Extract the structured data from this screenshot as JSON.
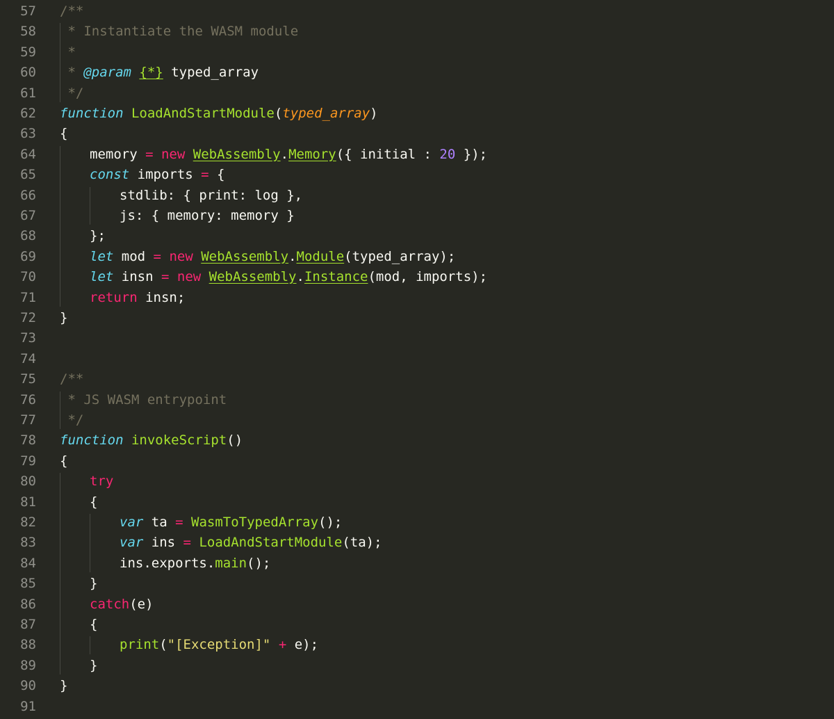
{
  "editor": {
    "background": "#272822",
    "lines": [
      {
        "num": "57",
        "indent": 0,
        "tokens": [
          {
            "t": "/**",
            "c": "c"
          }
        ]
      },
      {
        "num": "58",
        "indent": 0,
        "tokens": [
          {
            "t": " * Instantiate the WASM module",
            "c": "c"
          }
        ]
      },
      {
        "num": "59",
        "indent": 0,
        "tokens": [
          {
            "t": " *",
            "c": "c"
          }
        ]
      },
      {
        "num": "60",
        "indent": 0,
        "tokens": [
          {
            "t": " * ",
            "c": "c"
          },
          {
            "t": "@param",
            "c": "s"
          },
          {
            "t": " ",
            "c": "c"
          },
          {
            "t": "{*}",
            "c": "fu"
          },
          {
            "t": " typed_array",
            "c": "t"
          }
        ]
      },
      {
        "num": "61",
        "indent": 0,
        "tokens": [
          {
            "t": " */",
            "c": "c"
          }
        ]
      },
      {
        "num": "62",
        "indent": 0,
        "tokens": [
          {
            "t": "function",
            "c": "s"
          },
          {
            "t": " ",
            "c": "t"
          },
          {
            "t": "LoadAndStartModule",
            "c": "f"
          },
          {
            "t": "(",
            "c": "t"
          },
          {
            "t": "typed_array",
            "c": "p"
          },
          {
            "t": ")",
            "c": "t"
          }
        ]
      },
      {
        "num": "63",
        "indent": 0,
        "tokens": [
          {
            "t": "{",
            "c": "t"
          }
        ]
      },
      {
        "num": "64",
        "indent": 1,
        "tokens": [
          {
            "t": "memory ",
            "c": "t"
          },
          {
            "t": "=",
            "c": "k"
          },
          {
            "t": " ",
            "c": "t"
          },
          {
            "t": "new",
            "c": "k"
          },
          {
            "t": " ",
            "c": "t"
          },
          {
            "t": "WebAssembly",
            "c": "fu"
          },
          {
            "t": ".",
            "c": "t"
          },
          {
            "t": "Memory",
            "c": "fu"
          },
          {
            "t": "({ initial : ",
            "c": "t"
          },
          {
            "t": "20",
            "c": "n"
          },
          {
            "t": " });",
            "c": "t"
          }
        ]
      },
      {
        "num": "65",
        "indent": 1,
        "tokens": [
          {
            "t": "const",
            "c": "s"
          },
          {
            "t": " imports ",
            "c": "t"
          },
          {
            "t": "=",
            "c": "k"
          },
          {
            "t": " {",
            "c": "t"
          }
        ]
      },
      {
        "num": "66",
        "indent": 2,
        "tokens": [
          {
            "t": "stdlib: { print: log },",
            "c": "t"
          }
        ]
      },
      {
        "num": "67",
        "indent": 2,
        "tokens": [
          {
            "t": "js: { memory: memory }",
            "c": "t"
          }
        ]
      },
      {
        "num": "68",
        "indent": 1,
        "tokens": [
          {
            "t": "};",
            "c": "t"
          }
        ]
      },
      {
        "num": "69",
        "indent": 1,
        "tokens": [
          {
            "t": "let",
            "c": "s"
          },
          {
            "t": " mod ",
            "c": "t"
          },
          {
            "t": "=",
            "c": "k"
          },
          {
            "t": " ",
            "c": "t"
          },
          {
            "t": "new",
            "c": "k"
          },
          {
            "t": " ",
            "c": "t"
          },
          {
            "t": "WebAssembly",
            "c": "fu"
          },
          {
            "t": ".",
            "c": "t"
          },
          {
            "t": "Module",
            "c": "fu"
          },
          {
            "t": "(typed_array);",
            "c": "t"
          }
        ]
      },
      {
        "num": "70",
        "indent": 1,
        "tokens": [
          {
            "t": "let",
            "c": "s"
          },
          {
            "t": " insn ",
            "c": "t"
          },
          {
            "t": "=",
            "c": "k"
          },
          {
            "t": " ",
            "c": "t"
          },
          {
            "t": "new",
            "c": "k"
          },
          {
            "t": " ",
            "c": "t"
          },
          {
            "t": "WebAssembly",
            "c": "fu"
          },
          {
            "t": ".",
            "c": "t"
          },
          {
            "t": "Instance",
            "c": "fu"
          },
          {
            "t": "(mod, imports);",
            "c": "t"
          }
        ]
      },
      {
        "num": "71",
        "indent": 1,
        "tokens": [
          {
            "t": "return",
            "c": "k"
          },
          {
            "t": " insn;",
            "c": "t"
          }
        ]
      },
      {
        "num": "72",
        "indent": 0,
        "tokens": [
          {
            "t": "}",
            "c": "t"
          }
        ]
      },
      {
        "num": "73",
        "indent": 0,
        "tokens": []
      },
      {
        "num": "74",
        "indent": 0,
        "tokens": []
      },
      {
        "num": "75",
        "indent": 0,
        "tokens": [
          {
            "t": "/**",
            "c": "c"
          }
        ]
      },
      {
        "num": "76",
        "indent": 0,
        "tokens": [
          {
            "t": " * JS WASM entrypoint",
            "c": "c"
          }
        ]
      },
      {
        "num": "77",
        "indent": 0,
        "tokens": [
          {
            "t": " */",
            "c": "c"
          }
        ]
      },
      {
        "num": "78",
        "indent": 0,
        "tokens": [
          {
            "t": "function",
            "c": "s"
          },
          {
            "t": " ",
            "c": "t"
          },
          {
            "t": "invokeScript",
            "c": "f"
          },
          {
            "t": "()",
            "c": "t"
          }
        ]
      },
      {
        "num": "79",
        "indent": 0,
        "tokens": [
          {
            "t": "{",
            "c": "t"
          }
        ]
      },
      {
        "num": "80",
        "indent": 1,
        "tokens": [
          {
            "t": "try",
            "c": "k"
          }
        ]
      },
      {
        "num": "81",
        "indent": 1,
        "tokens": [
          {
            "t": "{",
            "c": "t"
          }
        ]
      },
      {
        "num": "82",
        "indent": 2,
        "tokens": [
          {
            "t": "var",
            "c": "s"
          },
          {
            "t": " ta ",
            "c": "t"
          },
          {
            "t": "=",
            "c": "k"
          },
          {
            "t": " ",
            "c": "t"
          },
          {
            "t": "WasmToTypedArray",
            "c": "f"
          },
          {
            "t": "();",
            "c": "t"
          }
        ]
      },
      {
        "num": "83",
        "indent": 2,
        "tokens": [
          {
            "t": "var",
            "c": "s"
          },
          {
            "t": " ins ",
            "c": "t"
          },
          {
            "t": "=",
            "c": "k"
          },
          {
            "t": " ",
            "c": "t"
          },
          {
            "t": "LoadAndStartModule",
            "c": "f"
          },
          {
            "t": "(ta);",
            "c": "t"
          }
        ]
      },
      {
        "num": "84",
        "indent": 2,
        "tokens": [
          {
            "t": "ins.exports.",
            "c": "t"
          },
          {
            "t": "main",
            "c": "f"
          },
          {
            "t": "();",
            "c": "t"
          }
        ]
      },
      {
        "num": "85",
        "indent": 1,
        "tokens": [
          {
            "t": "}",
            "c": "t"
          }
        ]
      },
      {
        "num": "86",
        "indent": 1,
        "tokens": [
          {
            "t": "catch",
            "c": "k"
          },
          {
            "t": "(e)",
            "c": "t"
          }
        ]
      },
      {
        "num": "87",
        "indent": 1,
        "tokens": [
          {
            "t": "{",
            "c": "t"
          }
        ]
      },
      {
        "num": "88",
        "indent": 2,
        "tokens": [
          {
            "t": "print",
            "c": "f"
          },
          {
            "t": "(",
            "c": "t"
          },
          {
            "t": "\"[Exception]\"",
            "c": "str"
          },
          {
            "t": " ",
            "c": "t"
          },
          {
            "t": "+",
            "c": "k"
          },
          {
            "t": " e);",
            "c": "t"
          }
        ]
      },
      {
        "num": "89",
        "indent": 1,
        "tokens": [
          {
            "t": "}",
            "c": "t"
          }
        ]
      },
      {
        "num": "90",
        "indent": 0,
        "tokens": [
          {
            "t": "}",
            "c": "t"
          }
        ]
      },
      {
        "num": "91",
        "indent": 0,
        "tokens": []
      }
    ]
  }
}
